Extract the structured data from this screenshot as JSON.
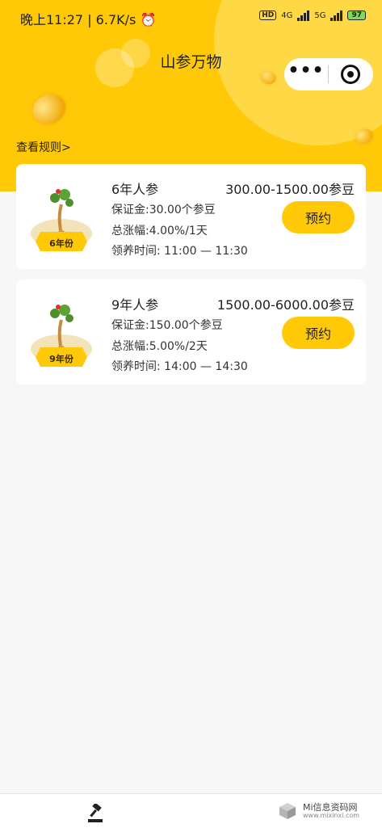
{
  "status_bar": {
    "time_speed": "晚上11:27 | 6.7K/s",
    "hd_label": "HD",
    "net_4g": "4G",
    "net_5g": "5G",
    "battery": "97"
  },
  "header": {
    "title": "山参万物",
    "rules_link": "查看规则>"
  },
  "products": [
    {
      "name": "6年人参",
      "price_range": "300.00-1500.00参豆",
      "deposit": "保证金:30.00个参豆",
      "growth": "总涨幅:4.00%/1天",
      "claim_time": "领养时间: 11:00 — 11:30",
      "badge": "6年份",
      "button_label": "预约"
    },
    {
      "name": "9年人参",
      "price_range": "1500.00-6000.00参豆",
      "deposit": "保证金:150.00个参豆",
      "growth": "总涨幅:5.00%/2天",
      "claim_time": "领养时间: 14:00 — 14:30",
      "badge": "9年份",
      "button_label": "预约"
    }
  ],
  "watermark": {
    "title": "Mi信息资码网",
    "url": "www.mixinxi.com"
  },
  "colors": {
    "brand_yellow": "#ffc908",
    "page_bg": "#f7f7f7"
  },
  "icons": [
    "alarm-icon",
    "signal-icon",
    "battery-icon",
    "more-icon",
    "target-icon",
    "gavel-icon",
    "cube-icon"
  ]
}
